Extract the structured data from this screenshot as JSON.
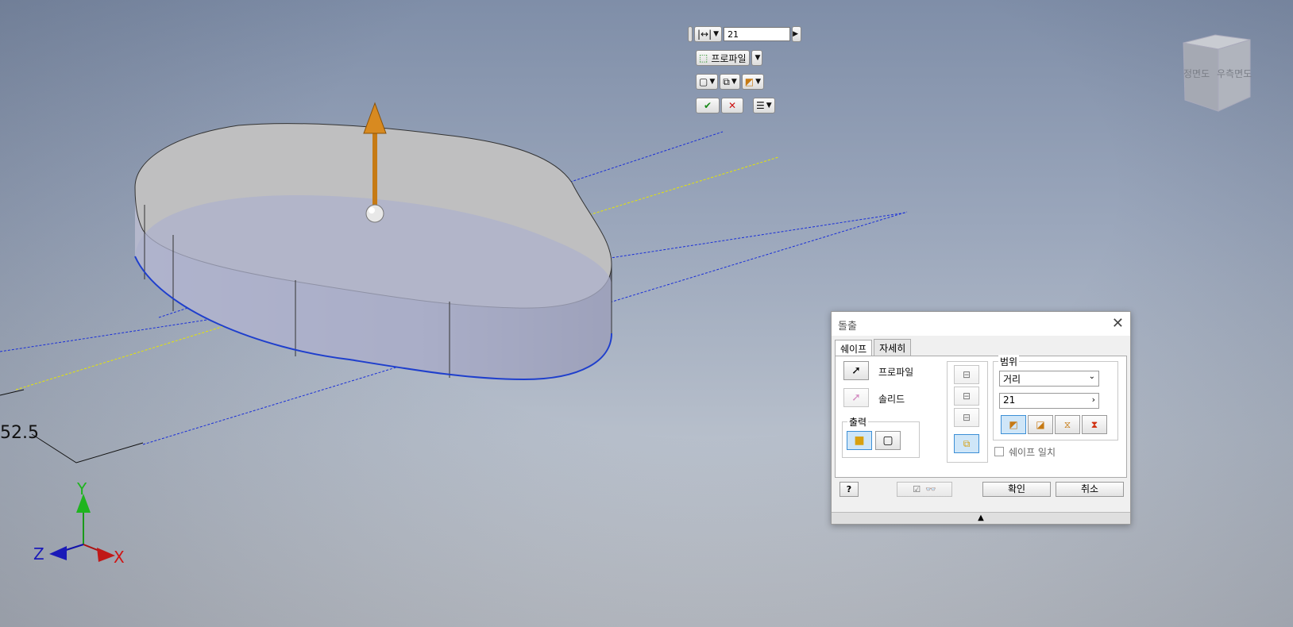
{
  "mini_toolbar": {
    "distance_value": "21",
    "profile_label": "프로파일"
  },
  "viewport": {
    "dimension_text": "52.5",
    "triad": {
      "x": "X",
      "y": "Y",
      "z": "Z"
    },
    "viewcube": {
      "front": "정면도",
      "right": "우측면도"
    }
  },
  "dialog": {
    "title": "돌출",
    "tabs": [
      "쉐이프",
      "자세히"
    ],
    "profile_label": "프로파일",
    "solid_label": "솔리드",
    "output_label": "출력",
    "extent_label": "범위",
    "extent_type": "거리",
    "distance_value": "21",
    "match_shape_label": "쉐이프 일치",
    "ok_label": "확인",
    "cancel_label": "취소"
  },
  "colors": {
    "accent": "#3c8fd6",
    "arrow": "#c67a14",
    "profile_blue": "#1f3fcc",
    "centerline_yellow": "#e6e600"
  }
}
